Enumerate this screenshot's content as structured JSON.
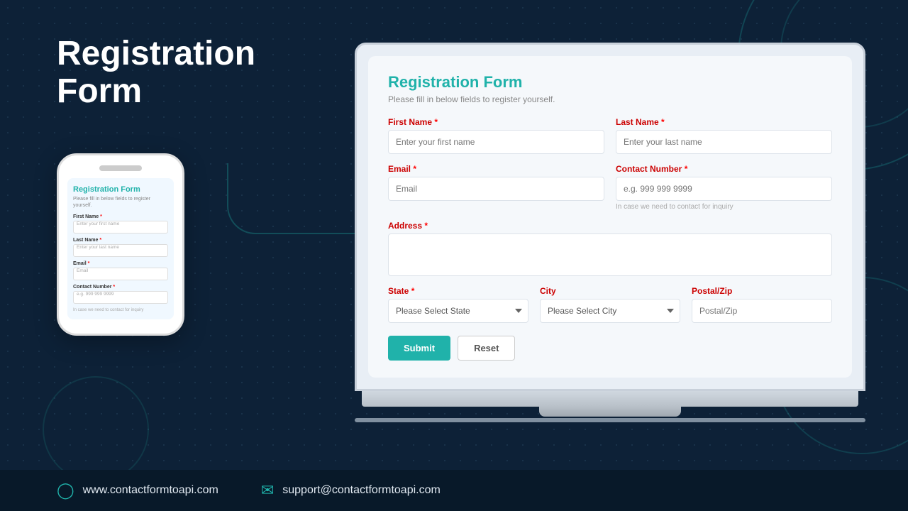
{
  "page": {
    "title": "Registration Form",
    "background_color": "#0d2137"
  },
  "header": {
    "title": "Registration Form"
  },
  "phone_form": {
    "title": "Registration Form",
    "subtitle": "Please fill in below fields to register yourself.",
    "fields": [
      {
        "label": "First Name",
        "required": true,
        "placeholder": "Enter your first name"
      },
      {
        "label": "Last Name",
        "required": true,
        "placeholder": "Enter your last name"
      },
      {
        "label": "Email",
        "required": true,
        "placeholder": "Email"
      },
      {
        "label": "Contact Number",
        "required": true,
        "placeholder": "e.g. 999 999 9999"
      }
    ],
    "hint": "In case we need to contact for inquiry"
  },
  "laptop_form": {
    "title": "Registration Form",
    "subtitle": "Please fill in below fields to register yourself.",
    "fields": {
      "first_name": {
        "label": "First Name",
        "required": true,
        "placeholder": "Enter your first name"
      },
      "last_name": {
        "label": "Last Name",
        "required": true,
        "placeholder": "Enter your last name"
      },
      "email": {
        "label": "Email",
        "required": true,
        "placeholder": "Email"
      },
      "contact_number": {
        "label": "Contact Number",
        "required": true,
        "placeholder": "e.g. 999 999 9999"
      },
      "contact_hint": "In case we need to contact for inquiry",
      "address": {
        "label": "Address",
        "required": true,
        "placeholder": ""
      },
      "state": {
        "label": "State",
        "required": true,
        "placeholder": "Please Select State"
      },
      "city": {
        "label": "City",
        "required": false,
        "placeholder": "Please Select City"
      },
      "postal_zip": {
        "label": "Postal/Zip",
        "required": false,
        "placeholder": "Postal/Zip"
      }
    },
    "buttons": {
      "submit": "Submit",
      "reset": "Reset"
    }
  },
  "footer": {
    "website": "www.contactformtoapi.com",
    "email": "support@contactformtoapi.com"
  }
}
